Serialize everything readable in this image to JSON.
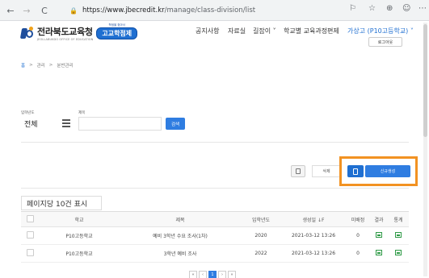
{
  "browser": {
    "back": "←",
    "forward": "→",
    "reload": "C",
    "lock": "🔒",
    "url_host": "https://www.jbecredit.kr",
    "url_path": "/manage/class-division/list",
    "ext1": "⚐",
    "ext2": "☆",
    "ext3": "⊕",
    "ext4": "☺",
    "more": "⋯"
  },
  "header": {
    "logo_title": "전라북도교육청",
    "logo_sub": "JEOLLABUKDO OFFICE OF EDUCATION",
    "logo_badge_top": "학점을 찾아서",
    "logo_badge": "고교학점제",
    "gnb": [
      "공지사항",
      "자료실",
      "길잡이 ˅",
      "학교별 교육과정편제",
      "가상고 (P10고등학교) ˅"
    ],
    "logout": "로그아웃"
  },
  "breadcrumb": {
    "home": "홈",
    "sep": ">",
    "level1": "관리",
    "level2": "분반관리"
  },
  "search": {
    "year_label": "입학년도",
    "year_value": "전체",
    "title_label": "제목",
    "title_value": "",
    "button": "검색"
  },
  "actions": {
    "delete": "삭제",
    "new": "신규생성"
  },
  "list": {
    "per_page": "페이지당 10건 표시",
    "headers": [
      "",
      "학교",
      "제목",
      "입학년도",
      "생성일 ↓F",
      "미배정",
      "결과",
      "통계"
    ],
    "rows": [
      {
        "school": "P10고등학교",
        "title": "예비 3학년 수요 조사(1차)",
        "year": "2020",
        "created": "2021-03-12 13:26",
        "unassigned": "0"
      },
      {
        "school": "P10고등학교",
        "title": "3학년 예비 조사",
        "year": "2022",
        "created": "2021-03-12 13:26",
        "unassigned": "0"
      }
    ]
  },
  "pagination": {
    "prev2": "«",
    "prev": "‹",
    "current": "1",
    "next": "›",
    "next2": "»"
  },
  "colors": {
    "accent": "#2f7de1",
    "highlight": "#f29222",
    "result_icon": "#2e9a46"
  }
}
